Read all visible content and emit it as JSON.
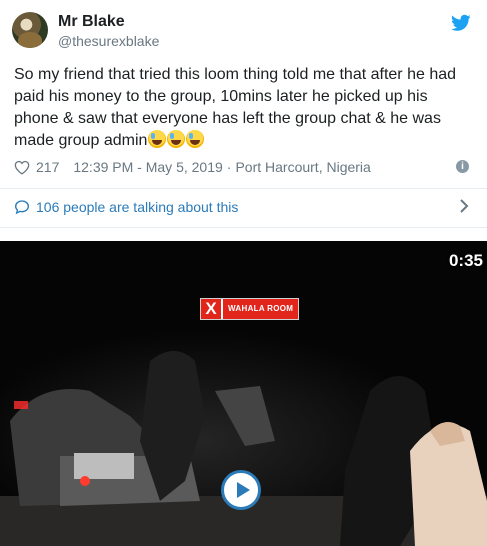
{
  "author": {
    "display_name": "Mr Blake",
    "handle": "@thesurexblake",
    "avatar_icon": "avatar-photo"
  },
  "tweet": {
    "text": "So my friend that tried this loom thing told me that after he had paid his money to the group, 10mins later he picked up his phone & saw that everyone has left the group chat & he was made group admin",
    "emoji": [
      "face-with-tears-of-joy",
      "face-with-tears-of-joy",
      "face-with-tears-of-joy"
    ]
  },
  "meta": {
    "like_count": "217",
    "timestamp": "12:39 PM - May 5, 2019",
    "separator": "·",
    "location": "Port Harcourt, Nigeria",
    "info_label": "i"
  },
  "conversation": {
    "label": "106 people are talking about this"
  },
  "video": {
    "duration": "0:35",
    "logo_letter": "X",
    "logo_text": "WAHALA ROOM"
  },
  "colors": {
    "twitter_blue": "#1da1f2",
    "link_blue": "#2b7bb9",
    "muted_gray": "#697882",
    "logo_red": "#e1251b"
  }
}
